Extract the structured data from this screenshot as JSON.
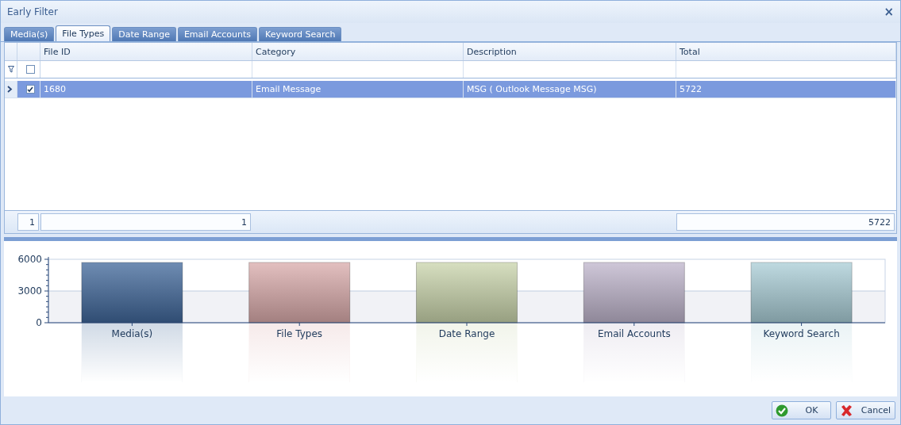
{
  "window": {
    "title": "Early Filter",
    "close": "×"
  },
  "tabs": [
    {
      "label": "Media(s)",
      "selected": false
    },
    {
      "label": "File Types",
      "selected": true
    },
    {
      "label": "Date Range",
      "selected": false
    },
    {
      "label": "Email Accounts",
      "selected": false
    },
    {
      "label": "Keyword Search",
      "selected": false
    }
  ],
  "table": {
    "columns": [
      "File ID",
      "Category",
      "Description",
      "Total"
    ],
    "filter_row": {
      "checked": false
    },
    "rows": [
      {
        "selected": true,
        "checked": true,
        "cells": [
          "1680",
          "Email Message",
          "MSG ( Outlook Message MSG)",
          "5722"
        ]
      }
    ],
    "footer": {
      "row_count": "1",
      "file_id_count": "1",
      "total_sum": "5722"
    }
  },
  "chart_data": {
    "type": "bar",
    "categories": [
      "Media(s)",
      "File Types",
      "Date Range",
      "Email Accounts",
      "Keyword Search"
    ],
    "series": [
      {
        "values": [
          5700,
          5700,
          5700,
          5700,
          5700
        ]
      }
    ],
    "ylim": [
      0,
      6000
    ],
    "yticks": [
      0,
      3000,
      6000
    ]
  },
  "buttons": [
    {
      "kind": "ok",
      "label": "OK"
    },
    {
      "kind": "cancel",
      "label": "Cancel"
    }
  ]
}
